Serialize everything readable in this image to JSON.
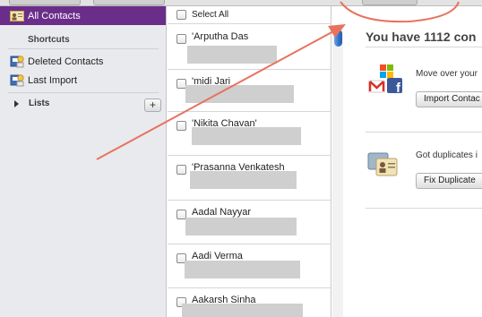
{
  "top": {
    "buttons": [
      "",
      ""
    ]
  },
  "sidebar": {
    "all_contacts": "All Contacts",
    "shortcuts_header": "Shortcuts",
    "items": [
      {
        "label": "Deleted Contacts",
        "icon": "deleted-contacts-icon"
      },
      {
        "label": "Last Import",
        "icon": "last-import-icon"
      }
    ],
    "lists_label": "Lists",
    "add_list": "+"
  },
  "contacts": {
    "select_all": "Select All",
    "rows": [
      {
        "name": "'Arputha Das"
      },
      {
        "name": "'midi Jari"
      },
      {
        "name": "'Nikita Chavan'"
      },
      {
        "name": "'Prasanna Venkatesh"
      },
      {
        "name": "Aadal Nayyar"
      },
      {
        "name": "Aadi Verma"
      },
      {
        "name": "Aakarsh Sinha"
      }
    ]
  },
  "main": {
    "title": "You have 1112 con",
    "import_text": "Move over your",
    "import_button": "Import Contac",
    "duplicates_text": "Got duplicates i",
    "duplicates_button": "Fix Duplicate"
  },
  "colors": {
    "selected": "#6b2d8a",
    "annotation": "#e8725e"
  }
}
